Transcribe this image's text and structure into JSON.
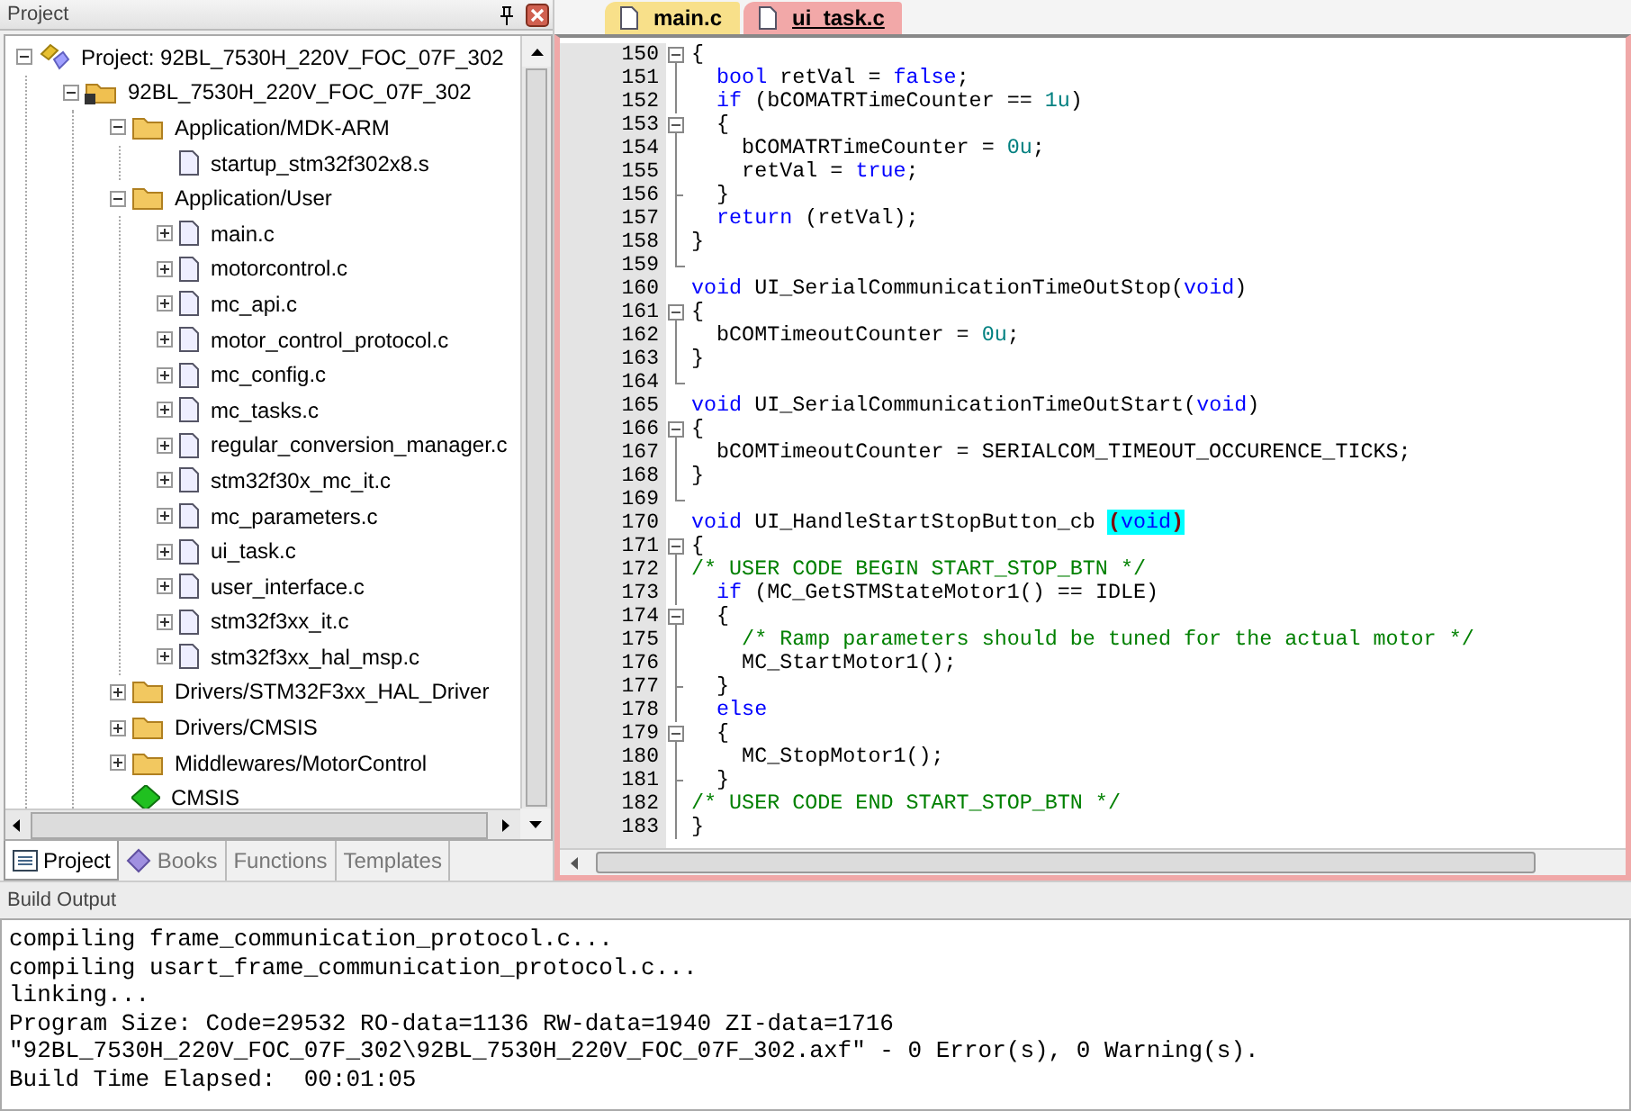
{
  "project_panel": {
    "title": "Project",
    "tree": [
      {
        "kind": "project",
        "label": "Project: 92BL_7530H_220V_FOC_07F_302",
        "expanded": true,
        "children": [
          {
            "kind": "target",
            "label": "92BL_7530H_220V_FOC_07F_302",
            "expanded": true,
            "children": [
              {
                "kind": "folder",
                "label": "Application/MDK-ARM",
                "expanded": true,
                "children": [
                  {
                    "kind": "file",
                    "label": "startup_stm32f302x8.s"
                  }
                ]
              },
              {
                "kind": "folder",
                "label": "Application/User",
                "expanded": true,
                "children": [
                  {
                    "kind": "file",
                    "label": "main.c",
                    "expanded": false
                  },
                  {
                    "kind": "file",
                    "label": "motorcontrol.c",
                    "expanded": false
                  },
                  {
                    "kind": "file",
                    "label": "mc_api.c",
                    "expanded": false
                  },
                  {
                    "kind": "file",
                    "label": "motor_control_protocol.c",
                    "expanded": false
                  },
                  {
                    "kind": "file",
                    "label": "mc_config.c",
                    "expanded": false
                  },
                  {
                    "kind": "file",
                    "label": "mc_tasks.c",
                    "expanded": false
                  },
                  {
                    "kind": "file",
                    "label": "regular_conversion_manager.c",
                    "expanded": false
                  },
                  {
                    "kind": "file",
                    "label": "stm32f30x_mc_it.c",
                    "expanded": false
                  },
                  {
                    "kind": "file",
                    "label": "mc_parameters.c",
                    "expanded": false
                  },
                  {
                    "kind": "file",
                    "label": "ui_task.c",
                    "expanded": false
                  },
                  {
                    "kind": "file",
                    "label": "user_interface.c",
                    "expanded": false
                  },
                  {
                    "kind": "file",
                    "label": "stm32f3xx_it.c",
                    "expanded": false
                  },
                  {
                    "kind": "file",
                    "label": "stm32f3xx_hal_msp.c",
                    "expanded": false
                  }
                ]
              },
              {
                "kind": "folder",
                "label": "Drivers/STM32F3xx_HAL_Driver",
                "expanded": false
              },
              {
                "kind": "folder",
                "label": "Drivers/CMSIS",
                "expanded": false
              },
              {
                "kind": "folder",
                "label": "Middlewares/MotorControl",
                "expanded": false
              },
              {
                "kind": "component",
                "label": "CMSIS"
              }
            ]
          }
        ]
      }
    ],
    "tabs": [
      {
        "kind": "project",
        "label": "Project",
        "selected": true
      },
      {
        "kind": "books",
        "label": "Books",
        "selected": false
      },
      {
        "kind": "functions",
        "label": "Functions",
        "selected": false
      },
      {
        "kind": "templates",
        "label": "Templates",
        "selected": false
      }
    ]
  },
  "editor": {
    "tabs": [
      {
        "label": "main.c",
        "selected": false
      },
      {
        "label": "ui_task.c",
        "selected": true
      }
    ],
    "lines": [
      {
        "number": "150",
        "kind": "fold-start",
        "tokens": [
          {
            "kind": "plain",
            "text": "{"
          }
        ]
      },
      {
        "number": "151",
        "kind": "fold-body",
        "tokens": [
          {
            "kind": "keyword",
            "text": "  bool"
          },
          {
            "kind": "plain",
            "text": " retVal = "
          },
          {
            "kind": "keyword",
            "text": "false"
          },
          {
            "kind": "plain",
            "text": ";"
          }
        ]
      },
      {
        "number": "152",
        "kind": "fold-body",
        "tokens": [
          {
            "kind": "keyword",
            "text": "  if"
          },
          {
            "kind": "plain",
            "text": " (bCOMATRTimeCounter == "
          },
          {
            "kind": "number",
            "text": "1u"
          },
          {
            "kind": "plain",
            "text": ")"
          }
        ]
      },
      {
        "number": "153",
        "kind": "fold-start",
        "tokens": [
          {
            "kind": "plain",
            "text": "  {"
          }
        ]
      },
      {
        "number": "154",
        "kind": "fold-body",
        "tokens": [
          {
            "kind": "plain",
            "text": "    bCOMATRTimeCounter = "
          },
          {
            "kind": "number",
            "text": "0u"
          },
          {
            "kind": "plain",
            "text": ";"
          }
        ]
      },
      {
        "number": "155",
        "kind": "fold-body",
        "tokens": [
          {
            "kind": "plain",
            "text": "    retVal = "
          },
          {
            "kind": "keyword",
            "text": "true"
          },
          {
            "kind": "plain",
            "text": ";"
          }
        ]
      },
      {
        "number": "156",
        "kind": "fold-close",
        "tokens": [
          {
            "kind": "plain",
            "text": "  }"
          }
        ]
      },
      {
        "number": "157",
        "kind": "fold-body",
        "tokens": [
          {
            "kind": "keyword",
            "text": "  return"
          },
          {
            "kind": "plain",
            "text": " (retVal);"
          }
        ]
      },
      {
        "number": "158",
        "kind": "fold-body",
        "tokens": [
          {
            "kind": "plain",
            "text": "}"
          }
        ]
      },
      {
        "number": "159",
        "kind": "fold-end"
      },
      {
        "number": "160",
        "kind": "plain",
        "tokens": [
          {
            "kind": "keyword",
            "text": "void"
          },
          {
            "kind": "plain",
            "text": " UI_SerialCommunicationTimeOutStop("
          },
          {
            "kind": "keyword",
            "text": "void"
          },
          {
            "kind": "plain",
            "text": ")"
          }
        ]
      },
      {
        "number": "161",
        "kind": "fold-start",
        "tokens": [
          {
            "kind": "plain",
            "text": "{"
          }
        ]
      },
      {
        "number": "162",
        "kind": "fold-body",
        "tokens": [
          {
            "kind": "plain",
            "text": "  bCOMTimeoutCounter = "
          },
          {
            "kind": "number",
            "text": "0u"
          },
          {
            "kind": "plain",
            "text": ";"
          }
        ]
      },
      {
        "number": "163",
        "kind": "fold-body",
        "tokens": [
          {
            "kind": "plain",
            "text": "}"
          }
        ]
      },
      {
        "number": "164",
        "kind": "fold-end"
      },
      {
        "number": "165",
        "kind": "plain",
        "tokens": [
          {
            "kind": "keyword",
            "text": "void"
          },
          {
            "kind": "plain",
            "text": " UI_SerialCommunicationTimeOutStart("
          },
          {
            "kind": "keyword",
            "text": "void"
          },
          {
            "kind": "plain",
            "text": ")"
          }
        ]
      },
      {
        "number": "166",
        "kind": "fold-start",
        "tokens": [
          {
            "kind": "plain",
            "text": "{"
          }
        ]
      },
      {
        "number": "167",
        "kind": "fold-body",
        "tokens": [
          {
            "kind": "plain",
            "text": "  bCOMTimeoutCounter = SERIALCOM_TIMEOUT_OCCURENCE_TICKS;"
          }
        ]
      },
      {
        "number": "168",
        "kind": "fold-body",
        "tokens": [
          {
            "kind": "plain",
            "text": "}"
          }
        ]
      },
      {
        "number": "169",
        "kind": "fold-end"
      },
      {
        "number": "170",
        "kind": "plain",
        "tokens": [
          {
            "kind": "keyword",
            "text": "void"
          },
          {
            "kind": "plain",
            "text": " UI_HandleStartStopButton_cb "
          },
          {
            "kind": "matched-paren",
            "text": "("
          },
          {
            "kind": "matched-keyword",
            "text": "void"
          },
          {
            "kind": "matched-paren",
            "text": ")"
          }
        ]
      },
      {
        "number": "171",
        "kind": "fold-start",
        "tokens": [
          {
            "kind": "plain",
            "text": "{"
          }
        ]
      },
      {
        "number": "172",
        "kind": "fold-body",
        "tokens": [
          {
            "kind": "comment",
            "text": "/* USER CODE BEGIN START_STOP_BTN */"
          }
        ]
      },
      {
        "number": "173",
        "kind": "fold-body",
        "tokens": [
          {
            "kind": "keyword",
            "text": "  if"
          },
          {
            "kind": "plain",
            "text": " (MC_GetSTMStateMotor1() == IDLE)"
          }
        ]
      },
      {
        "number": "174",
        "kind": "fold-start",
        "tokens": [
          {
            "kind": "plain",
            "text": "  {"
          }
        ]
      },
      {
        "number": "175",
        "kind": "fold-body",
        "tokens": [
          {
            "kind": "comment",
            "text": "    /* Ramp parameters should be tuned for the actual motor */"
          }
        ]
      },
      {
        "number": "176",
        "kind": "fold-body",
        "tokens": [
          {
            "kind": "plain",
            "text": "    MC_StartMotor1();"
          }
        ]
      },
      {
        "number": "177",
        "kind": "fold-close",
        "tokens": [
          {
            "kind": "plain",
            "text": "  }"
          }
        ]
      },
      {
        "number": "178",
        "kind": "fold-body",
        "tokens": [
          {
            "kind": "keyword",
            "text": "  else"
          }
        ]
      },
      {
        "number": "179",
        "kind": "fold-start",
        "tokens": [
          {
            "kind": "plain",
            "text": "  {"
          }
        ]
      },
      {
        "number": "180",
        "kind": "fold-body",
        "tokens": [
          {
            "kind": "plain",
            "text": "    MC_StopMotor1();"
          }
        ]
      },
      {
        "number": "181",
        "kind": "fold-close",
        "tokens": [
          {
            "kind": "plain",
            "text": "  }"
          }
        ]
      },
      {
        "number": "182",
        "kind": "fold-body",
        "tokens": [
          {
            "kind": "comment",
            "text": "/* USER CODE END START_STOP_BTN */"
          }
        ]
      },
      {
        "number": "183",
        "kind": "fold-body",
        "tokens": [
          {
            "kind": "plain",
            "text": "}"
          }
        ]
      }
    ]
  },
  "build_output": {
    "title": "Build Output",
    "lines": [
      "compiling frame_communication_protocol.c...",
      "compiling usart_frame_communication_protocol.c...",
      "linking...",
      "Program Size: Code=29532 RO-data=1136 RW-data=1940 ZI-data=1716",
      "\"92BL_7530H_220V_FOC_07F_302\\92BL_7530H_220V_FOC_07F_302.axf\" - 0 Error(s), 0 Warning(s).",
      "Build Time Elapsed:  00:01:05"
    ]
  }
}
